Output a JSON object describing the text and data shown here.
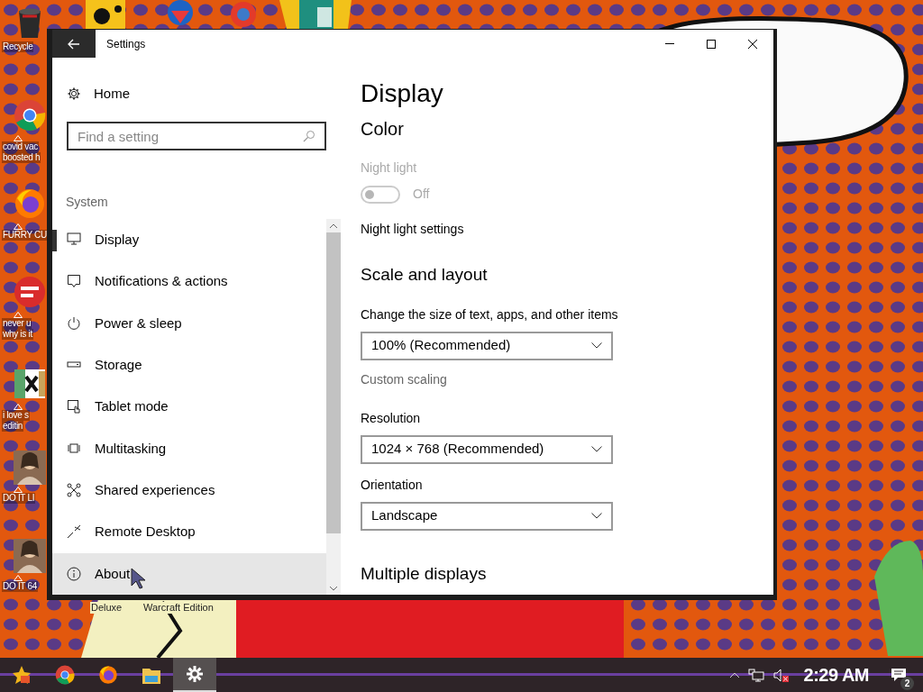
{
  "desktop_icons": [
    {
      "kind": "recycle",
      "lines": [
        "Recycle"
      ],
      "shortcut": false
    },
    {
      "kind": "chrome",
      "lines": [
        "covid vac",
        "boosted h"
      ],
      "shortcut": true
    },
    {
      "kind": "firefox",
      "lines": [
        "FURRY CU"
      ],
      "shortcut": true
    },
    {
      "kind": "devcpp",
      "lines": [
        "never u",
        "why is it"
      ],
      "shortcut": true
    },
    {
      "kind": "hex",
      "lines": [
        "i love s",
        "editin"
      ],
      "shortcut": true
    },
    {
      "kind": "portrait",
      "lines": [
        "DO IT LI"
      ],
      "shortcut": true
    },
    {
      "kind": "portrait",
      "lines": [
        "DO IT 64"
      ],
      "shortcut": true
    }
  ],
  "bottom_labels": [
    "Deluxe",
    "Warcraft Edition"
  ],
  "window": {
    "title": "Settings"
  },
  "sidebar": {
    "home": "Home",
    "search": {
      "placeholder": "Find a setting"
    },
    "section": "System",
    "items": [
      {
        "label": "Display",
        "selected": true,
        "hovered": false
      },
      {
        "label": "Notifications & actions",
        "selected": false,
        "hovered": false
      },
      {
        "label": "Power & sleep",
        "selected": false,
        "hovered": false
      },
      {
        "label": "Storage",
        "selected": false,
        "hovered": false
      },
      {
        "label": "Tablet mode",
        "selected": false,
        "hovered": false
      },
      {
        "label": "Multitasking",
        "selected": false,
        "hovered": false
      },
      {
        "label": "Shared experiences",
        "selected": false,
        "hovered": false
      },
      {
        "label": "Remote Desktop",
        "selected": false,
        "hovered": false
      },
      {
        "label": "About",
        "selected": false,
        "hovered": true
      }
    ]
  },
  "content": {
    "heading": "Display",
    "color": {
      "title": "Color",
      "night_light": {
        "label": "Night light",
        "disabled": true,
        "on": false,
        "state": "Off"
      },
      "link": "Night light settings"
    },
    "scale": {
      "title": "Scale and layout",
      "size_label": "Change the size of text, apps, and other items",
      "size_value": "100% (Recommended)",
      "custom_scaling": "Custom scaling",
      "resolution_label": "Resolution",
      "resolution_value": "1024 × 768 (Recommended)",
      "orientation_label": "Orientation",
      "orientation_value": "Landscape"
    },
    "multiple": {
      "title": "Multiple displays"
    }
  },
  "taskbar": {
    "apps": [
      {
        "kind": "game",
        "selected": false
      },
      {
        "kind": "chrome",
        "selected": false
      },
      {
        "kind": "firefox",
        "selected": false
      },
      {
        "kind": "folder",
        "selected": false
      },
      {
        "kind": "settings",
        "selected": true
      }
    ],
    "clock": "2:29 AM",
    "notifications": "2"
  }
}
